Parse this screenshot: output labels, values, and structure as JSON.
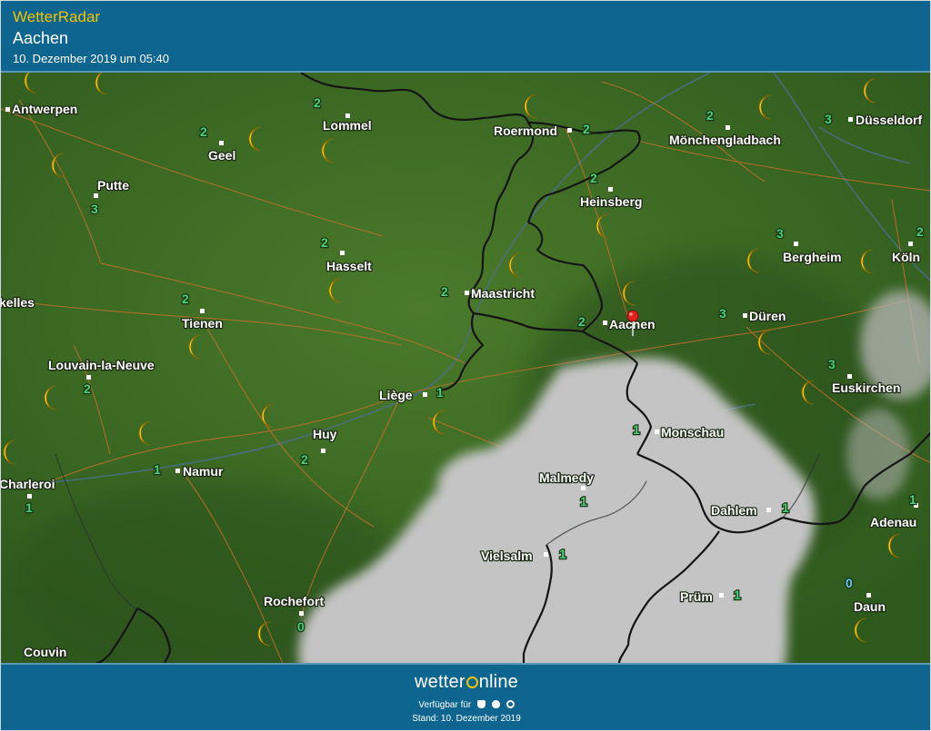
{
  "header": {
    "app_title": "WetterRadar",
    "location": "Aachen",
    "timestamp": "10. Dezember 2019 um 05:40"
  },
  "map": {
    "cities": [
      {
        "name": "Antwerpen"
      },
      {
        "name": "Lommel"
      },
      {
        "name": "Roermond"
      },
      {
        "name": "Mönchengladbach"
      },
      {
        "name": "Düsseldorf"
      },
      {
        "name": "Geel"
      },
      {
        "name": "Putte"
      },
      {
        "name": "Heinsberg"
      },
      {
        "name": "Hasselt"
      },
      {
        "name": "Bergheim"
      },
      {
        "name": "Köln"
      },
      {
        "name": "Maastricht"
      },
      {
        "name": "kelles"
      },
      {
        "name": "Tienen"
      },
      {
        "name": "Aachen"
      },
      {
        "name": "Düren"
      },
      {
        "name": "Louvain-la-Neuve"
      },
      {
        "name": "Liège"
      },
      {
        "name": "Euskirchen"
      },
      {
        "name": "Huy"
      },
      {
        "name": "Monschau"
      },
      {
        "name": "Namur"
      },
      {
        "name": "Charleroi"
      },
      {
        "name": "Malmedy"
      },
      {
        "name": "Dahlem"
      },
      {
        "name": "Adenau"
      },
      {
        "name": "Vielsalm"
      },
      {
        "name": "Prüm"
      },
      {
        "name": "Rochefort"
      },
      {
        "name": "Daun"
      },
      {
        "name": "Couvin"
      }
    ],
    "wind_values": [
      "2",
      "2",
      "2",
      "3",
      "2",
      "3",
      "2",
      "3",
      "2",
      "2",
      "2",
      "2",
      "2",
      "3",
      "3",
      "2",
      "1",
      "2",
      "1",
      "1",
      "1",
      "1",
      "1",
      "1",
      "1",
      "1",
      "0"
    ],
    "weather_icon": "moon-icon",
    "location_marker": "red-pin-icon",
    "colors": {
      "land": "#3b6a24",
      "cloud": "#c4c4c4",
      "border": "#1a1a1a",
      "road": "#c8702a",
      "river": "#4a6f8c",
      "moon": "#f5cf1a",
      "wind_green": "#4ad07a",
      "wind_blue": "#6ac8f0"
    }
  },
  "footer": {
    "brand_prefix": "wetter",
    "brand_suffix": "nline",
    "available_label": "Verfügbar für",
    "platform_icons": [
      "android-icon",
      "apple-icon",
      "windows-icon"
    ],
    "stand": "Stand: 10. Dezember 2019"
  }
}
